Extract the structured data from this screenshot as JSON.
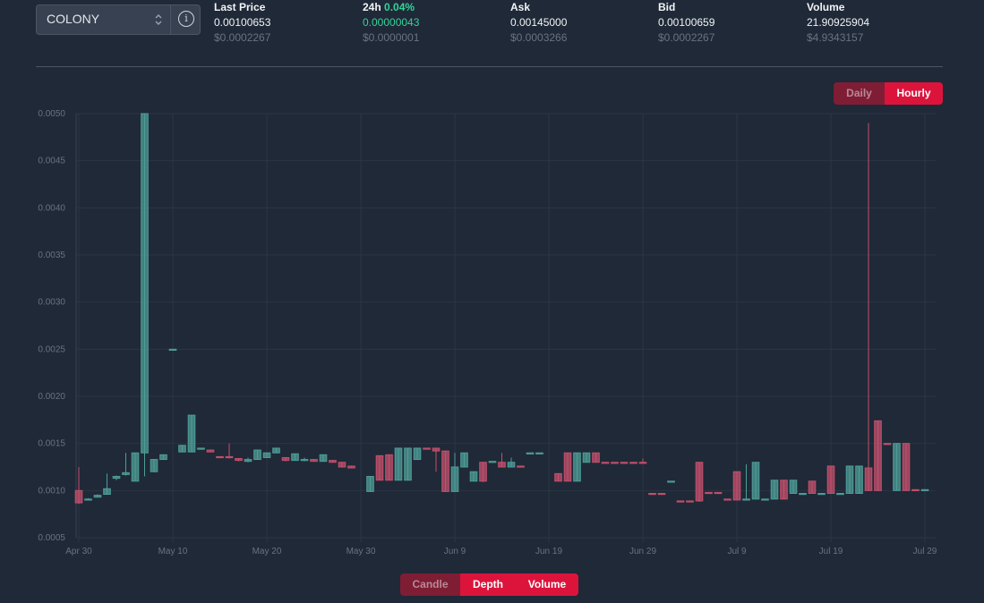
{
  "market": {
    "selected": "COLONY"
  },
  "stats": {
    "last_price": {
      "label": "Last Price",
      "value": "0.00100653",
      "usd": "$0.0002267"
    },
    "change_24h": {
      "label": "24h",
      "pct": "0.04%",
      "value": "0.00000043",
      "usd": "$0.0000001"
    },
    "ask": {
      "label": "Ask",
      "value": "0.00145000",
      "usd": "$0.0003266"
    },
    "bid": {
      "label": "Bid",
      "value": "0.00100659",
      "usd": "$0.0002267"
    },
    "volume": {
      "label": "Volume",
      "value": "21.90925904",
      "usd": "$4.9343157"
    }
  },
  "interval_toggle": {
    "daily": "Daily",
    "hourly": "Hourly",
    "active": "hourly"
  },
  "view_toggle": {
    "candle": "Candle",
    "depth": "Depth",
    "volume": "Volume",
    "active": "candle"
  },
  "colors": {
    "up": "#4f9d98",
    "down": "#c4506d",
    "grid": "#2b3544",
    "axis_text": "#6b7280",
    "accent": "#dc143c"
  },
  "chart_data": {
    "type": "candlestick",
    "ylim": [
      0.0005,
      0.005
    ],
    "y_ticks": [
      "0.0005",
      "0.0010",
      "0.0015",
      "0.0020",
      "0.0025",
      "0.0030",
      "0.0035",
      "0.0040",
      "0.0045",
      "0.0050"
    ],
    "x_ticks": [
      {
        "label": "Apr 30",
        "day": 0
      },
      {
        "label": "May 10",
        "day": 10
      },
      {
        "label": "May 20",
        "day": 20
      },
      {
        "label": "May 30",
        "day": 30
      },
      {
        "label": "Jun 9",
        "day": 40
      },
      {
        "label": "Jun 19",
        "day": 50
      },
      {
        "label": "Jun 29",
        "day": 60
      },
      {
        "label": "Jul 9",
        "day": 70
      },
      {
        "label": "Jul 19",
        "day": 80
      },
      {
        "label": "Jul 29",
        "day": 90
      }
    ],
    "candles": [
      {
        "day": 0,
        "o": 0.001,
        "h": 0.00125,
        "l": 0.00086,
        "c": 0.00087
      },
      {
        "day": 1,
        "o": 0.00091,
        "h": 0.00092,
        "l": 0.0009,
        "c": 0.00091
      },
      {
        "day": 2,
        "o": 0.00093,
        "h": 0.00096,
        "l": 0.00093,
        "c": 0.00095
      },
      {
        "day": 3,
        "o": 0.00096,
        "h": 0.00118,
        "l": 0.00096,
        "c": 0.00102
      },
      {
        "day": 4,
        "o": 0.00113,
        "h": 0.00116,
        "l": 0.00111,
        "c": 0.00115
      },
      {
        "day": 5,
        "o": 0.00117,
        "h": 0.0014,
        "l": 0.00116,
        "c": 0.00119
      },
      {
        "day": 6,
        "o": 0.0011,
        "h": 0.0014,
        "l": 0.0011,
        "c": 0.0014
      },
      {
        "day": 7,
        "o": 0.0014,
        "h": 0.005,
        "l": 0.00115,
        "c": 0.005
      },
      {
        "day": 8,
        "o": 0.0012,
        "h": 0.00133,
        "l": 0.0012,
        "c": 0.00133
      },
      {
        "day": 9,
        "o": 0.00133,
        "h": 0.00138,
        "l": 0.00133,
        "c": 0.00138
      },
      {
        "day": 10,
        "o": 0.0025,
        "h": 0.0025,
        "l": 0.0025,
        "c": 0.0025
      },
      {
        "day": 11,
        "o": 0.00141,
        "h": 0.00148,
        "l": 0.00141,
        "c": 0.00148
      },
      {
        "day": 12,
        "o": 0.00141,
        "h": 0.0018,
        "l": 0.00141,
        "c": 0.0018
      },
      {
        "day": 13,
        "o": 0.00145,
        "h": 0.00145,
        "l": 0.00144,
        "c": 0.00145
      },
      {
        "day": 14,
        "o": 0.00143,
        "h": 0.00143,
        "l": 0.00141,
        "c": 0.00141
      },
      {
        "day": 15,
        "o": 0.00136,
        "h": 0.00136,
        "l": 0.00135,
        "c": 0.00135
      },
      {
        "day": 16,
        "o": 0.00136,
        "h": 0.0015,
        "l": 0.00134,
        "c": 0.00135
      },
      {
        "day": 17,
        "o": 0.00134,
        "h": 0.00134,
        "l": 0.00131,
        "c": 0.00132
      },
      {
        "day": 18,
        "o": 0.00131,
        "h": 0.00135,
        "l": 0.0013,
        "c": 0.00133
      },
      {
        "day": 19,
        "o": 0.00133,
        "h": 0.00143,
        "l": 0.00133,
        "c": 0.00143
      },
      {
        "day": 20,
        "o": 0.00135,
        "h": 0.0014,
        "l": 0.00135,
        "c": 0.0014
      },
      {
        "day": 21,
        "o": 0.0014,
        "h": 0.00145,
        "l": 0.0014,
        "c": 0.00145
      },
      {
        "day": 22,
        "o": 0.00135,
        "h": 0.00135,
        "l": 0.00131,
        "c": 0.00132
      },
      {
        "day": 23,
        "o": 0.00132,
        "h": 0.00139,
        "l": 0.00132,
        "c": 0.00139
      },
      {
        "day": 24,
        "o": 0.00132,
        "h": 0.00135,
        "l": 0.00131,
        "c": 0.00133
      },
      {
        "day": 25,
        "o": 0.00133,
        "h": 0.00133,
        "l": 0.00131,
        "c": 0.00131
      },
      {
        "day": 26,
        "o": 0.00131,
        "h": 0.00138,
        "l": 0.00131,
        "c": 0.00138
      },
      {
        "day": 27,
        "o": 0.00132,
        "h": 0.00132,
        "l": 0.0013,
        "c": 0.0013
      },
      {
        "day": 28,
        "o": 0.0013,
        "h": 0.0013,
        "l": 0.00125,
        "c": 0.00125
      },
      {
        "day": 29,
        "o": 0.00126,
        "h": 0.00126,
        "l": 0.00124,
        "c": 0.00124
      },
      {
        "day": 31,
        "o": 0.00099,
        "h": 0.00115,
        "l": 0.00099,
        "c": 0.00115
      },
      {
        "day": 32,
        "o": 0.00137,
        "h": 0.00137,
        "l": 0.00111,
        "c": 0.00111
      },
      {
        "day": 33,
        "o": 0.00138,
        "h": 0.00138,
        "l": 0.00111,
        "c": 0.00111
      },
      {
        "day": 34,
        "o": 0.00111,
        "h": 0.00145,
        "l": 0.00111,
        "c": 0.00145
      },
      {
        "day": 35,
        "o": 0.00111,
        "h": 0.00145,
        "l": 0.00111,
        "c": 0.00145
      },
      {
        "day": 36,
        "o": 0.00133,
        "h": 0.00145,
        "l": 0.00133,
        "c": 0.00145
      },
      {
        "day": 37,
        "o": 0.00145,
        "h": 0.00145,
        "l": 0.00144,
        "c": 0.00144
      },
      {
        "day": 38,
        "o": 0.00145,
        "h": 0.00145,
        "l": 0.0012,
        "c": 0.00142
      },
      {
        "day": 39,
        "o": 0.00142,
        "h": 0.00142,
        "l": 0.00099,
        "c": 0.00099
      },
      {
        "day": 40,
        "o": 0.00099,
        "h": 0.0014,
        "l": 0.00099,
        "c": 0.00125
      },
      {
        "day": 41,
        "o": 0.00125,
        "h": 0.0014,
        "l": 0.00125,
        "c": 0.0014
      },
      {
        "day": 42,
        "o": 0.0011,
        "h": 0.0012,
        "l": 0.0011,
        "c": 0.0012
      },
      {
        "day": 43,
        "o": 0.0013,
        "h": 0.0013,
        "l": 0.00109,
        "c": 0.0011
      },
      {
        "day": 44,
        "o": 0.0013,
        "h": 0.00131,
        "l": 0.0013,
        "c": 0.00131
      },
      {
        "day": 45,
        "o": 0.0013,
        "h": 0.0014,
        "l": 0.00125,
        "c": 0.00125
      },
      {
        "day": 46,
        "o": 0.00125,
        "h": 0.00135,
        "l": 0.00125,
        "c": 0.0013
      },
      {
        "day": 47,
        "o": 0.00126,
        "h": 0.00126,
        "l": 0.00125,
        "c": 0.00125
      },
      {
        "day": 48,
        "o": 0.0014,
        "h": 0.0014,
        "l": 0.0014,
        "c": 0.0014
      },
      {
        "day": 49,
        "o": 0.0014,
        "h": 0.0014,
        "l": 0.0014,
        "c": 0.0014
      },
      {
        "day": 51,
        "o": 0.00118,
        "h": 0.00118,
        "l": 0.0011,
        "c": 0.0011
      },
      {
        "day": 52,
        "o": 0.0014,
        "h": 0.0014,
        "l": 0.0011,
        "c": 0.0011
      },
      {
        "day": 53,
        "o": 0.0011,
        "h": 0.0014,
        "l": 0.0011,
        "c": 0.0014
      },
      {
        "day": 54,
        "o": 0.0013,
        "h": 0.0014,
        "l": 0.0013,
        "c": 0.0014
      },
      {
        "day": 55,
        "o": 0.0014,
        "h": 0.0014,
        "l": 0.0013,
        "c": 0.0013
      },
      {
        "day": 56,
        "o": 0.0013,
        "h": 0.0013,
        "l": 0.00129,
        "c": 0.00129
      },
      {
        "day": 57,
        "o": 0.0013,
        "h": 0.0013,
        "l": 0.00129,
        "c": 0.00129
      },
      {
        "day": 58,
        "o": 0.0013,
        "h": 0.0013,
        "l": 0.00129,
        "c": 0.00129
      },
      {
        "day": 59,
        "o": 0.0013,
        "h": 0.0013,
        "l": 0.00129,
        "c": 0.00129
      },
      {
        "day": 60,
        "o": 0.0013,
        "h": 0.00134,
        "l": 0.00129,
        "c": 0.00129
      },
      {
        "day": 61,
        "o": 0.00097,
        "h": 0.00097,
        "l": 0.00096,
        "c": 0.00096
      },
      {
        "day": 62,
        "o": 0.00097,
        "h": 0.00097,
        "l": 0.00096,
        "c": 0.00096
      },
      {
        "day": 63,
        "o": 0.0011,
        "h": 0.0011,
        "l": 0.0011,
        "c": 0.0011
      },
      {
        "day": 64,
        "o": 0.00089,
        "h": 0.00089,
        "l": 0.00088,
        "c": 0.00088
      },
      {
        "day": 65,
        "o": 0.00089,
        "h": 0.00089,
        "l": 0.00088,
        "c": 0.00088
      },
      {
        "day": 66,
        "o": 0.0013,
        "h": 0.0013,
        "l": 0.00088,
        "c": 0.00089
      },
      {
        "day": 67,
        "o": 0.00098,
        "h": 0.00098,
        "l": 0.00097,
        "c": 0.00097
      },
      {
        "day": 68,
        "o": 0.00098,
        "h": 0.00098,
        "l": 0.00097,
        "c": 0.00097
      },
      {
        "day": 69,
        "o": 0.00091,
        "h": 0.00091,
        "l": 0.0009,
        "c": 0.0009
      },
      {
        "day": 70,
        "o": 0.0012,
        "h": 0.0012,
        "l": 0.0009,
        "c": 0.0009
      },
      {
        "day": 71,
        "o": 0.00091,
        "h": 0.00128,
        "l": 0.00091,
        "c": 0.00091
      },
      {
        "day": 72,
        "o": 0.00091,
        "h": 0.0013,
        "l": 0.00091,
        "c": 0.0013
      },
      {
        "day": 73,
        "o": 0.00091,
        "h": 0.00091,
        "l": 0.0009,
        "c": 0.00091
      },
      {
        "day": 74,
        "o": 0.00091,
        "h": 0.00111,
        "l": 0.00091,
        "c": 0.00111
      },
      {
        "day": 75,
        "o": 0.00111,
        "h": 0.00111,
        "l": 0.00091,
        "c": 0.00091
      },
      {
        "day": 76,
        "o": 0.00097,
        "h": 0.00111,
        "l": 0.00097,
        "c": 0.00111
      },
      {
        "day": 77,
        "o": 0.00097,
        "h": 0.00097,
        "l": 0.00096,
        "c": 0.00097
      },
      {
        "day": 78,
        "o": 0.0011,
        "h": 0.0011,
        "l": 0.00097,
        "c": 0.00097
      },
      {
        "day": 79,
        "o": 0.00097,
        "h": 0.00097,
        "l": 0.00096,
        "c": 0.00097
      },
      {
        "day": 80,
        "o": 0.00126,
        "h": 0.00126,
        "l": 0.00097,
        "c": 0.00097
      },
      {
        "day": 81,
        "o": 0.00097,
        "h": 0.00097,
        "l": 0.00096,
        "c": 0.00097
      },
      {
        "day": 82,
        "o": 0.00097,
        "h": 0.00126,
        "l": 0.00097,
        "c": 0.00126
      },
      {
        "day": 83,
        "o": 0.00097,
        "h": 0.00126,
        "l": 0.00097,
        "c": 0.00126
      },
      {
        "day": 84,
        "o": 0.00124,
        "h": 0.0049,
        "l": 0.001,
        "c": 0.001
      },
      {
        "day": 85,
        "o": 0.00174,
        "h": 0.00174,
        "l": 0.001,
        "c": 0.001
      },
      {
        "day": 86,
        "o": 0.0015,
        "h": 0.0015,
        "l": 0.00149,
        "c": 0.00149
      },
      {
        "day": 87,
        "o": 0.001,
        "h": 0.0015,
        "l": 0.001,
        "c": 0.0015
      },
      {
        "day": 88,
        "o": 0.0015,
        "h": 0.0015,
        "l": 0.001,
        "c": 0.001
      },
      {
        "day": 89,
        "o": 0.00101,
        "h": 0.00101,
        "l": 0.001,
        "c": 0.001
      },
      {
        "day": 90,
        "o": 0.00101,
        "h": 0.00101,
        "l": 0.001,
        "c": 0.00101
      }
    ]
  }
}
